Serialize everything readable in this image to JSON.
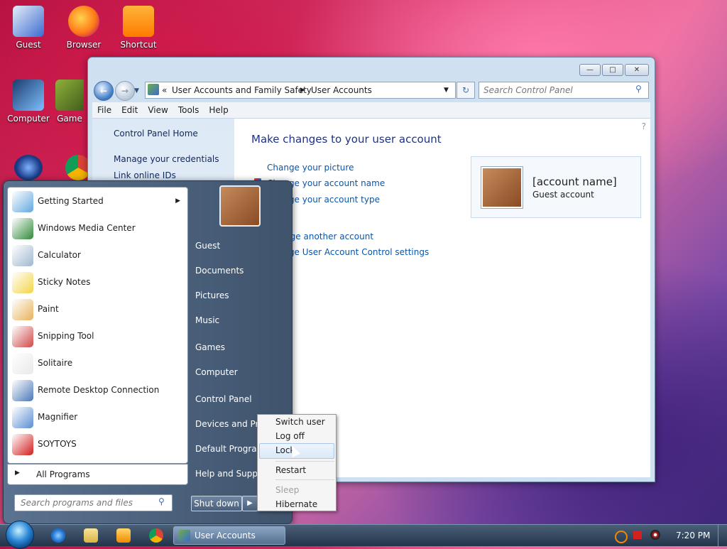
{
  "desktop": {
    "icons": [
      {
        "label": "Guest",
        "color": "#3a6bd0"
      },
      {
        "label": "Browser",
        "color": "#ff7a18"
      },
      {
        "label": "Shortcut",
        "color": "#ff8a00"
      },
      {
        "label": "Computer",
        "color": "#4d8fd8"
      },
      {
        "label": "Game",
        "color": "#8fb03a"
      }
    ]
  },
  "explorer": {
    "breadcrumb": [
      "User Accounts and Family Safety",
      "User Accounts"
    ],
    "search_placeholder": "Search Control Panel",
    "menu": [
      "File",
      "Edit",
      "View",
      "Tools",
      "Help"
    ],
    "left_links": [
      "Control Panel Home",
      "Manage your credentials",
      "Link online IDs"
    ],
    "title": "Make changes to your user account",
    "links": [
      "Change your picture",
      "Change your account name",
      "Change your account type",
      "Manage another account",
      "Change User Account Control settings"
    ],
    "user": {
      "name": "[account name]",
      "type": "Guest account"
    },
    "caption_buttons": [
      "—",
      "□",
      "✕"
    ]
  },
  "start_menu": {
    "programs": [
      {
        "label": "Getting Started",
        "color": "#62a8e0",
        "submenu": true
      },
      {
        "label": "Windows Media Center",
        "color": "#2f8a3a"
      },
      {
        "label": "Calculator",
        "color": "#9fb7cf"
      },
      {
        "label": "Sticky Notes",
        "color": "#f3d547"
      },
      {
        "label": "Paint",
        "color": "#e8b25c"
      },
      {
        "label": "Snipping Tool",
        "color": "#d14848"
      },
      {
        "label": "Solitaire",
        "color": "#e9e9e9"
      },
      {
        "label": "Remote Desktop Connection",
        "color": "#4a78b8"
      },
      {
        "label": "Magnifier",
        "color": "#5b8dd4"
      },
      {
        "label": "SOYTOYS",
        "color": "#d41d1d"
      }
    ],
    "all_programs": "All Programs",
    "search_placeholder": "Search programs and files",
    "right_links": [
      "Guest",
      "Documents",
      "Pictures",
      "Music",
      "Games",
      "Computer",
      "Control Panel",
      "Devices and Printers",
      "Default Programs",
      "Help and Support"
    ],
    "shutdown_label": "Shut down",
    "shutdown_arrow": "▶"
  },
  "shutdown_menu": {
    "items": [
      "Switch user",
      "Log off",
      "Lock",
      "Restart",
      "Sleep",
      "Hibernate"
    ]
  },
  "taskbar": {
    "task_label": "User Accounts",
    "clock": "7:20 PM"
  }
}
